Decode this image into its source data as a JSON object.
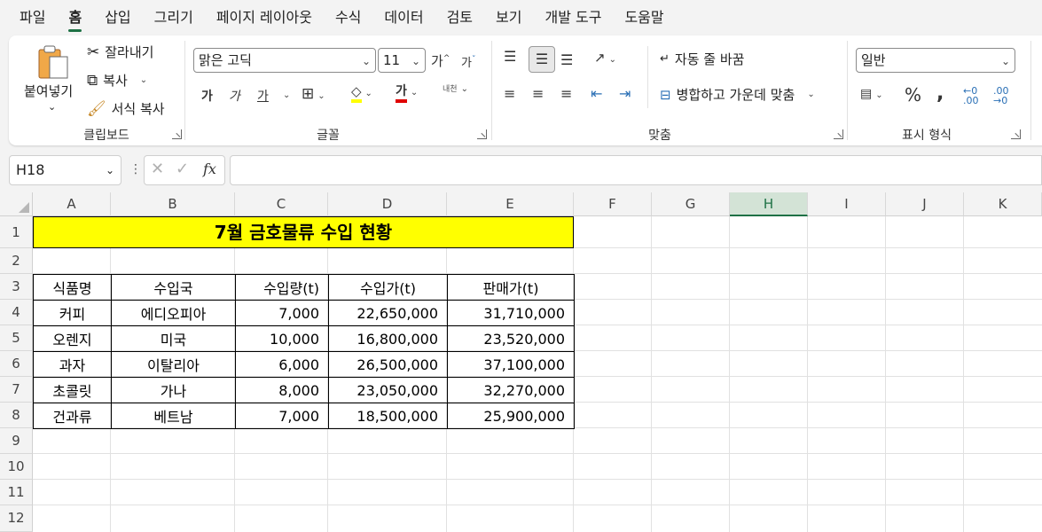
{
  "menu": [
    "파일",
    "홈",
    "삽입",
    "그리기",
    "페이지 레이아웃",
    "수식",
    "데이터",
    "검토",
    "보기",
    "개발 도구",
    "도움말"
  ],
  "active_menu_index": 1,
  "accent_color": "#1e7145",
  "ribbon": {
    "clipboard": {
      "paste": "붙여넣기",
      "cut": "잘라내기",
      "copy": "복사",
      "format_painter": "서식 복사",
      "label": "클립보드"
    },
    "font": {
      "font_name": "맑은 고딕",
      "font_size": "11",
      "grow": "가",
      "shrink": "가",
      "bold": "가",
      "italic": "가",
      "underline": "가",
      "font_color_glyph": "가",
      "phonetic": "내천",
      "label": "글꼴"
    },
    "alignment": {
      "wrap_text": "자동 줄 바꿈",
      "merge_center": "병합하고 가운데 맞춤",
      "label": "맞춤"
    },
    "number": {
      "format": "일반",
      "label": "표시 형식"
    }
  },
  "formula_bar": {
    "name_box": "H18",
    "fx": "fx",
    "formula": ""
  },
  "grid": {
    "columns": [
      "A",
      "B",
      "C",
      "D",
      "E",
      "F",
      "G",
      "H",
      "I",
      "J",
      "K"
    ],
    "selected_column": "H",
    "rows": [
      "1",
      "2",
      "3",
      "4",
      "5",
      "6",
      "7",
      "8",
      "9",
      "10",
      "11",
      "12"
    ]
  },
  "sheet": {
    "title": "7월 금호물류 수입 현황",
    "headers": [
      "식품명",
      "수입국",
      "수입량(t)",
      "수입가(t)",
      "판매가(t)"
    ],
    "rows": [
      [
        "커피",
        "에디오피아",
        "7,000",
        "22,650,000",
        "31,710,000"
      ],
      [
        "오렌지",
        "미국",
        "10,000",
        "16,800,000",
        "23,520,000"
      ],
      [
        "과자",
        "이탈리아",
        "6,000",
        "26,500,000",
        "37,100,000"
      ],
      [
        "초콜릿",
        "가나",
        "8,000",
        "23,050,000",
        "32,270,000"
      ],
      [
        "건과류",
        "베트남",
        "7,000",
        "18,500,000",
        "25,900,000"
      ]
    ],
    "title_fill": "#ffff00"
  }
}
